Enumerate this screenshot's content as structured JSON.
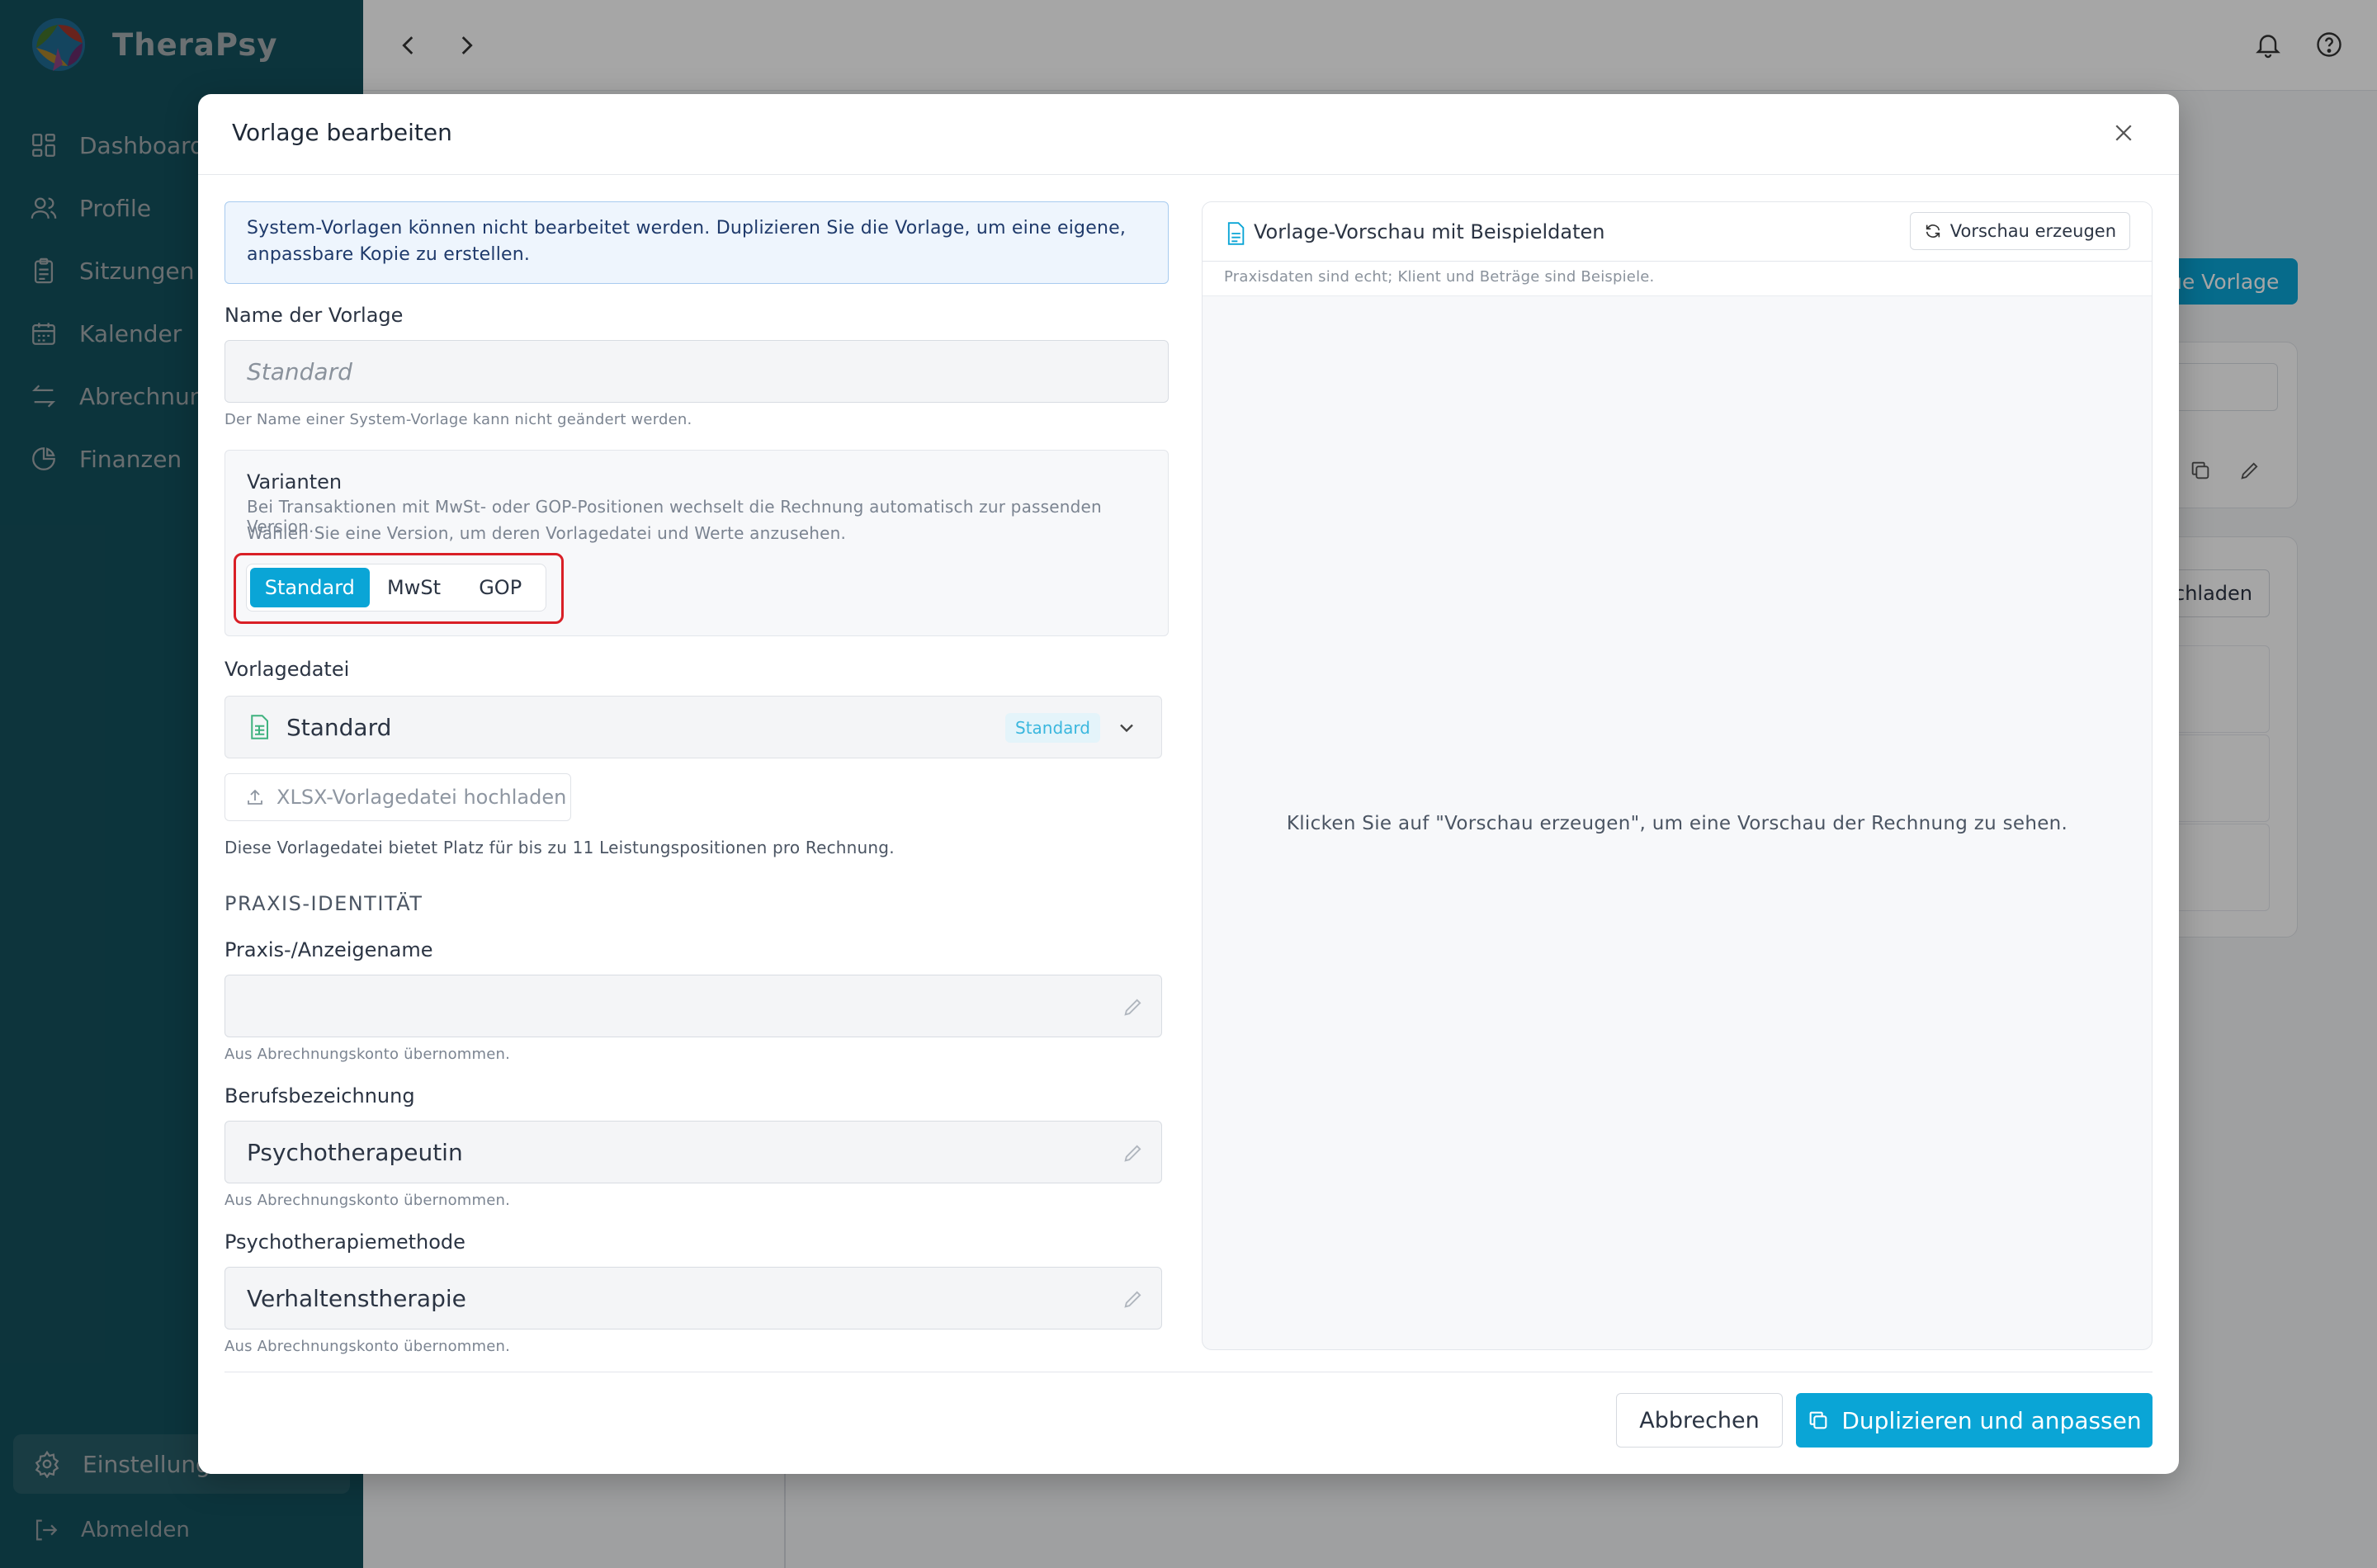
{
  "app": {
    "name": "TheraPsy"
  },
  "sidebar": {
    "items": [
      {
        "label": "Dashboard",
        "icon": "dashboard-icon"
      },
      {
        "label": "Profile",
        "icon": "users-icon"
      },
      {
        "label": "Sitzungen",
        "icon": "clipboard-icon"
      },
      {
        "label": "Kalender",
        "icon": "calendar-icon"
      },
      {
        "label": "Abrechnung",
        "icon": "transfer-icon"
      },
      {
        "label": "Finanzen",
        "icon": "pie-chart-icon"
      }
    ],
    "settings_label": "Einstellungen",
    "logout_label": "Abmelden"
  },
  "background": {
    "new_template_button": "ue Vorlage",
    "upload_button_partial": "chladen"
  },
  "modal": {
    "title": "Vorlage bearbeiten",
    "info": "System-Vorlagen können nicht bearbeitet werden. Duplizieren Sie die Vorlage, um eine eigene, anpassbare Kopie zu erstellen.",
    "name_label": "Name der Vorlage",
    "name_value": "Standard",
    "name_hint": "Der Name einer System-Vorlage kann nicht geändert werden.",
    "variants": {
      "title": "Varianten",
      "description_line1": "Bei Transaktionen mit MwSt- oder GOP-Positionen wechselt die Rechnung automatisch zur passenden Version.",
      "description_line2": "Wählen Sie eine Version, um deren Vorlagedatei und Werte anzusehen.",
      "options": [
        "Standard",
        "MwSt",
        "GOP"
      ],
      "selected": "Standard"
    },
    "template_file": {
      "label": "Vorlagedatei",
      "value": "Standard",
      "tag": "Standard",
      "upload_label": "XLSX-Vorlagedatei hochladen",
      "hint": "Diese Vorlagedatei bietet Platz für bis zu 11 Leistungspositionen pro Rechnung."
    },
    "practice": {
      "section_title": "PRAXIS-IDENTITÄT",
      "display_name_label": "Praxis-/Anzeigename",
      "display_name_value": "",
      "display_name_hint": "Aus Abrechnungskonto übernommen.",
      "profession_label": "Berufsbezeichnung",
      "profession_value": "Psychotherapeutin",
      "profession_hint": "Aus Abrechnungskonto übernommen.",
      "method_label": "Psychotherapiemethode",
      "method_value": "Verhaltenstherapie",
      "method_hint": "Aus Abrechnungskonto übernommen."
    },
    "preview": {
      "title": "Vorlage-Vorschau mit Beispieldaten",
      "button": "Vorschau erzeugen",
      "note": "Praxisdaten sind echt; Klient und Beträge sind Beispiele.",
      "empty": "Klicken Sie auf \"Vorschau erzeugen\", um eine Vorschau der Rechnung zu sehen."
    },
    "cancel_label": "Abbrechen",
    "primary_label": "Duplizieren und anpassen"
  },
  "colors": {
    "accent": "#0aa5d6",
    "sidebar": "#1a6c7d",
    "highlight": "#d91f26"
  }
}
